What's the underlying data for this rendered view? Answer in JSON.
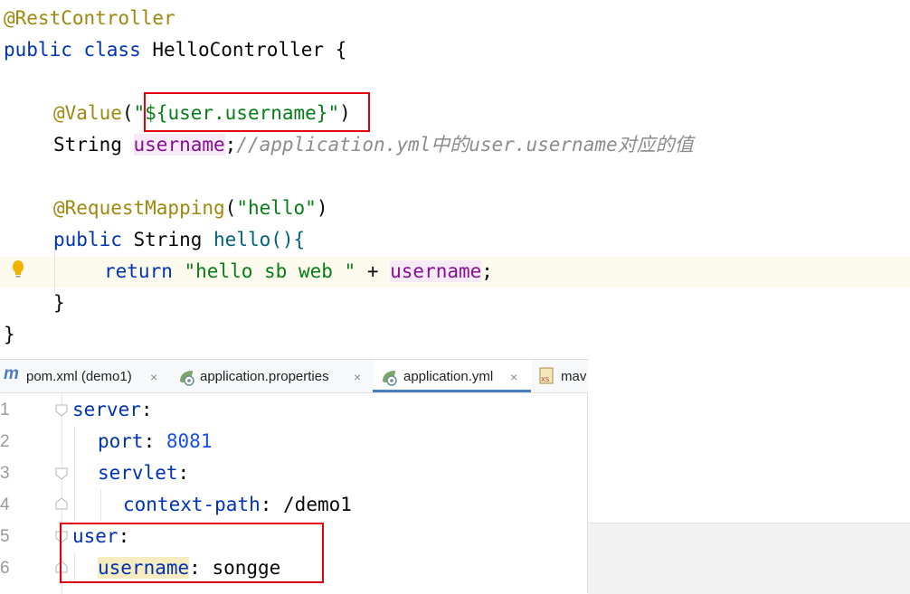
{
  "java_editor": {
    "line1": {
      "annotation": "@RestController"
    },
    "line2": {
      "kw": "public class",
      "name": "HelloController",
      "brace": "{"
    },
    "line4": {
      "annotation": "@Value",
      "paren_open": "(",
      "value": "\"${user.username}\"",
      "paren_close": ")"
    },
    "line5": {
      "type": "String",
      "field": "username",
      "semi": ";",
      "comment": "//application.yml中的user.username对应的值"
    },
    "line7": {
      "annotation": "@RequestMapping",
      "paren_open": "(",
      "value": "\"hello\"",
      "paren_close": ")"
    },
    "line8": {
      "kw": "public",
      "type": "String",
      "method": "hello(){"
    },
    "line9": {
      "kw": "return",
      "value": "\"hello sb web \"",
      "op": "+",
      "field": "username",
      "semi": ";"
    },
    "line10": {
      "brace": "}"
    },
    "line11": {
      "brace": "}"
    }
  },
  "yaml_editor": {
    "tabs": [
      {
        "label": "pom.xml (demo1)",
        "icon": "maven-icon",
        "close": "×"
      },
      {
        "label": "application.properties",
        "icon": "spring-leaf-icon",
        "close": "×"
      },
      {
        "label": "application.yml",
        "icon": "spring-leaf-icon",
        "close": "×",
        "active": true
      },
      {
        "label": "mav",
        "icon": "xsd-file-icon"
      }
    ],
    "line_numbers": [
      "1",
      "2",
      "3",
      "4",
      "5",
      "6"
    ],
    "lines": [
      {
        "key": "server",
        "colon": ":"
      },
      {
        "key": "port",
        "colon": ":",
        "value": "8081"
      },
      {
        "key": "servlet",
        "colon": ":"
      },
      {
        "key": "context-path",
        "colon": ":",
        "value": "/demo1"
      },
      {
        "key": "user",
        "colon": ":"
      },
      {
        "key": "username",
        "colon": ":",
        "value": "songge"
      }
    ]
  },
  "colors": {
    "annotation": "#9e880d",
    "keyword": "#0033b3",
    "string": "#067d17",
    "field": "#871094",
    "comment": "#8c8c8c",
    "highlight_box": "#e3000f",
    "tab_active": "#4a7ec2"
  }
}
